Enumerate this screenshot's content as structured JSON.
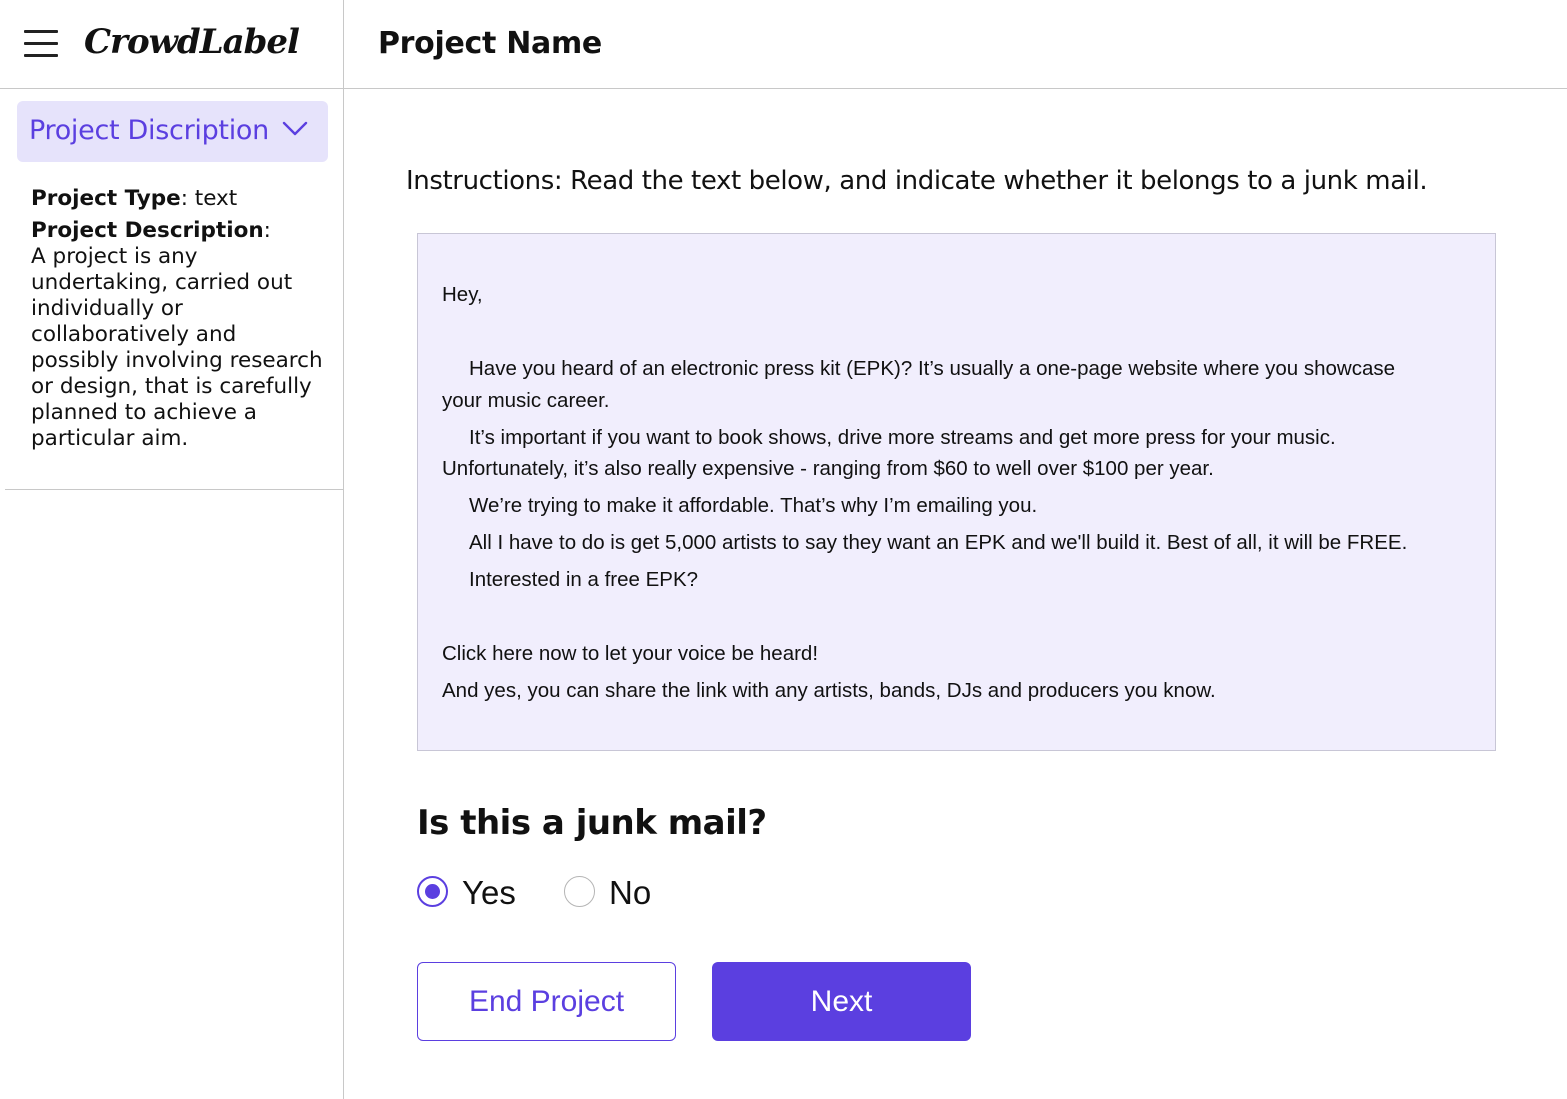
{
  "app": {
    "brand": "CrowdLabel"
  },
  "sidebar": {
    "toggle_label": "Project Discription",
    "project_type_label": "Project Type",
    "project_type_value": ": text",
    "project_description_label": "Project Description",
    "project_description_colon": ":",
    "project_description_text": "A project is any undertaking, carried out individually or collaboratively and possibly involving research or design, that is carefully planned to achieve a particular aim."
  },
  "header": {
    "title": "Project Name"
  },
  "main": {
    "instructions": "Instructions: Read the text below, and indicate whether it belongs to a junk mail.",
    "mail": {
      "greeting": "Hey,",
      "p1_line1": "Have you heard of an electronic press kit (EPK)? It’s usually a one-page website where you showcase",
      "p1_line2": "your music career.",
      "p2_line1": "It’s important if you want to book shows, drive more streams and get more press for your music.",
      "p2_line2": "Unfortunately, it’s also really expensive - ranging from $60 to well over $100 per year.",
      "p3": "We’re trying to make it affordable. That’s why I’m emailing you.",
      "p4": "All I have to do is get 5,000 artists to say they want an EPK and we'll build it. Best of all, it will be FREE.",
      "p5": "Interested in a free EPK?",
      "cta": "Click here now to let your voice be heard!",
      "closing": "And yes, you can share the link with any artists, bands, DJs and producers you know."
    },
    "question": "Is this a junk mail?",
    "options": [
      {
        "label": "Yes",
        "selected": true
      },
      {
        "label": "No",
        "selected": false
      }
    ],
    "end_button": "End Project",
    "next_button": "Next"
  },
  "colors": {
    "accent": "#5b3fe0",
    "toggle_bg": "#e6e3fb",
    "mail_bg": "#f1eefd"
  }
}
